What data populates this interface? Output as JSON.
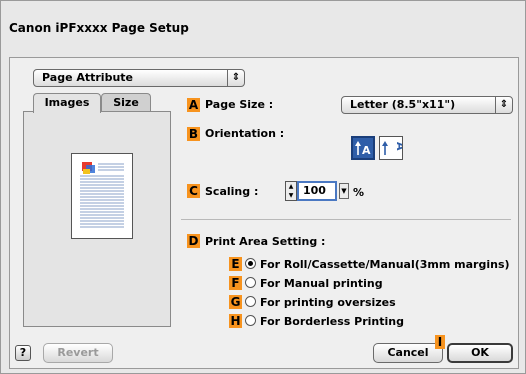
{
  "window": {
    "title": "Canon iPFxxxx Page Setup"
  },
  "panel_popup": {
    "value": "Page Attribute"
  },
  "tabs": [
    {
      "label": "Images",
      "active": true
    },
    {
      "label": "Size",
      "active": false
    }
  ],
  "markers": {
    "A": "A",
    "B": "B",
    "C": "C",
    "D": "D",
    "E": "E",
    "F": "F",
    "G": "G",
    "H": "H",
    "I": "I"
  },
  "page_size": {
    "label": "Page Size :",
    "value": "Letter (8.5\"x11\")"
  },
  "orientation": {
    "label": "Orientation :",
    "selected": "portrait"
  },
  "scaling": {
    "label": "Scaling :",
    "value": "100",
    "unit": "%"
  },
  "print_area": {
    "label": "Print Area Setting :",
    "options": [
      {
        "label": "For Roll/Cassette/Manual(3mm margins)",
        "checked": true
      },
      {
        "label": "For Manual printing",
        "checked": false
      },
      {
        "label": "For printing oversizes",
        "checked": false
      },
      {
        "label": "For Borderless Printing",
        "checked": false
      }
    ]
  },
  "buttons": {
    "help": "?",
    "revert": "Revert",
    "cancel": "Cancel",
    "ok": "OK"
  },
  "colors": {
    "marker": "#f7931e",
    "selected_orientation": "#2f5ea8"
  },
  "icons": {
    "popup": "updown-arrows-icon",
    "portrait": "portrait-orientation-icon",
    "landscape": "landscape-orientation-icon"
  }
}
